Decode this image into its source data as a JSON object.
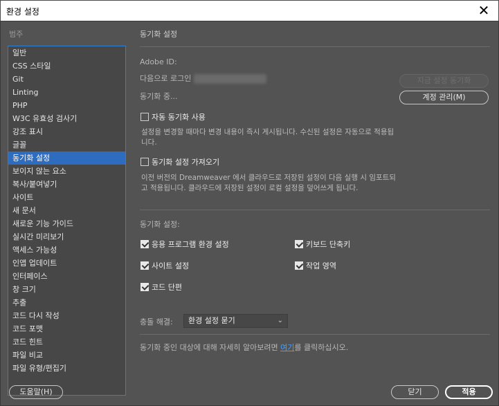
{
  "window": {
    "title": "환경 설정",
    "close_glyph": "✕"
  },
  "sidebar": {
    "heading": "범주",
    "items": [
      {
        "label": "일반"
      },
      {
        "label": "CSS 스타일"
      },
      {
        "label": "Git"
      },
      {
        "label": "Linting"
      },
      {
        "label": "PHP"
      },
      {
        "label": "W3C 유효성 검사기"
      },
      {
        "label": "강조 표시"
      },
      {
        "label": "글꼴"
      },
      {
        "label": "동기화 설정"
      },
      {
        "label": "보이지 않는 요소"
      },
      {
        "label": "복사/붙여넣기"
      },
      {
        "label": "사이트"
      },
      {
        "label": "새 문서"
      },
      {
        "label": "새로운 기능 가이드"
      },
      {
        "label": "실시간 미리보기"
      },
      {
        "label": "액세스 가능성"
      },
      {
        "label": "인앱 업데이트"
      },
      {
        "label": "인터페이스"
      },
      {
        "label": "창 크기"
      },
      {
        "label": "추출"
      },
      {
        "label": "코드 다시 작성"
      },
      {
        "label": "코드 포맷"
      },
      {
        "label": "코드 힌트"
      },
      {
        "label": "파일 비교"
      },
      {
        "label": "파일 유형/편집기"
      }
    ],
    "selected_index": 8
  },
  "panel": {
    "title": "동기화 설정",
    "adobe_id_label": "Adobe ID:",
    "login_prefix": "다음으로 로그인",
    "sync_status": "동기화 중...",
    "sync_now_button": "지금 설정 동기화",
    "manage_account_button": "계정 관리(M)",
    "auto_sync": {
      "label": "자동 동기화 사용",
      "checked": false,
      "description": "설정을 변경할 때마다 변경 내용이 즉시 게시됩니다. 수신된 설정은 자동으로 적용됩니다."
    },
    "import_sync": {
      "label": "동기화 설정 가져오기",
      "checked": false,
      "description": "이전 버전의 Dreamweaver 에서 클라우드로 저장된 설정이 다음 실행 시 임포트되고 적용됩니다. 클라우드에 저장된 설정이 로컬 설정을 덮어쓰게 됩니다."
    },
    "sync_settings_label": "동기화 설정:",
    "options": {
      "app_prefs": {
        "label": "응용 프로그램 환경 설정",
        "checked": true
      },
      "keyboard": {
        "label": "키보드 단축키",
        "checked": true
      },
      "site": {
        "label": "사이트 설정",
        "checked": true
      },
      "workspace": {
        "label": "작업 영역",
        "checked": true
      },
      "snippets": {
        "label": "코드 단편",
        "checked": true
      }
    },
    "conflict_label": "충돌 해결:",
    "conflict_value": "환경 설정 묻기",
    "footer_prefix": "동기화 중인 대상에 대해 자세히 알아보려면 ",
    "footer_link": "여기",
    "footer_suffix": "를 클릭하십시오."
  },
  "buttons": {
    "help": "도움말(H)",
    "close": "닫기",
    "apply": "적용"
  }
}
